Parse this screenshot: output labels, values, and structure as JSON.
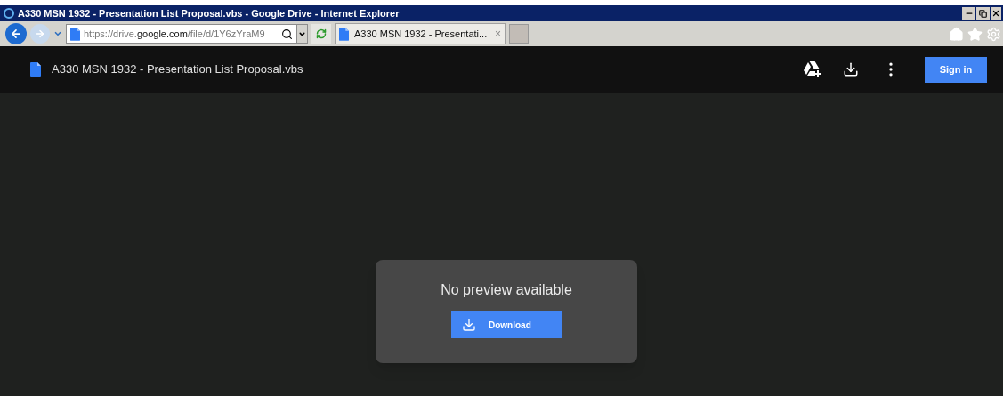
{
  "window": {
    "title": "A330 MSN 1932 - Presentation List Proposal.vbs - Google Drive - Internet Explorer"
  },
  "address_bar": {
    "prefix": "https://drive.",
    "domain": "google.com",
    "path": "/file/d/1Y6zYraM9"
  },
  "tabs": [
    {
      "label": "A330 MSN 1932 - Presentati...",
      "close": "×",
      "selected": true
    }
  ],
  "header": {
    "file_name": "A330 MSN 1932 - Presentation List Proposal.vbs",
    "sign_in": "Sign in"
  },
  "dialog": {
    "message": "No preview available",
    "button": "Download"
  }
}
